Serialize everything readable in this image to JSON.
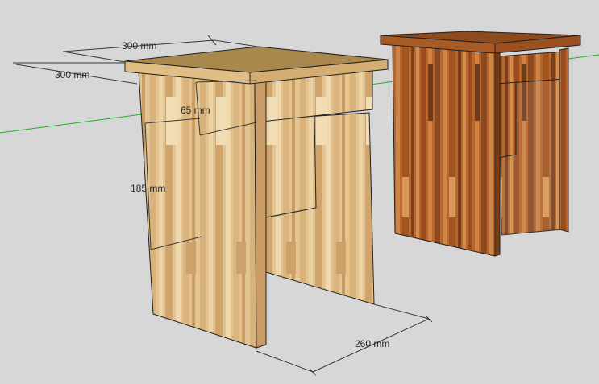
{
  "viewport": {
    "background": "#d7d7d7",
    "axis_color": "#22b022"
  },
  "dimensions": {
    "top_depth": "300 mm",
    "top_width": "300 mm",
    "apron_height": "65 mm",
    "leg_height": "185 mm",
    "base_width": "260 mm"
  },
  "models": {
    "light_stool": {
      "wood_color": "#e2c08c",
      "edge_color": "#222222"
    },
    "dark_stool": {
      "wood_color": "#b5622a",
      "edge_color": "#222222"
    }
  }
}
